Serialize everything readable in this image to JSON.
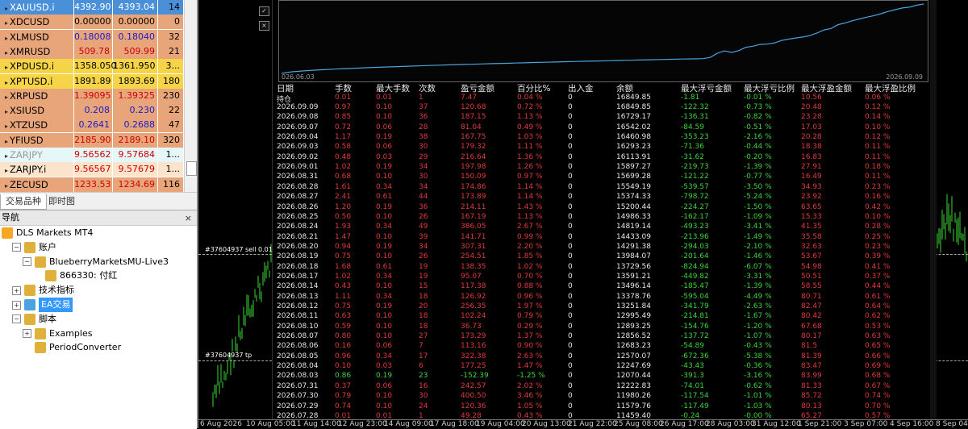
{
  "market_watch": {
    "rows": [
      {
        "symbol": "XAUUSD.i",
        "bid": "4392.90",
        "ask": "4393.04",
        "spread": "14",
        "bg": "#4a90d9",
        "bidcolor": "#ffffff",
        "askcolor": "#ffffff",
        "symcolor": "#ffffff"
      },
      {
        "symbol": "XDCUSD",
        "bid": "0.00000",
        "ask": "0.00000",
        "spread": "0",
        "bg": "#e8a57a",
        "bidcolor": "#000000",
        "askcolor": "#000000",
        "symcolor": "#000000"
      },
      {
        "symbol": "XLMUSD",
        "bid": "0.18008",
        "ask": "0.18040",
        "spread": "32",
        "bg": "#e8a57a",
        "bidcolor": "#1a1acc",
        "askcolor": "#1a1acc",
        "symcolor": "#000000"
      },
      {
        "symbol": "XMRUSD",
        "bid": "509.78",
        "ask": "509.99",
        "spread": "21",
        "bg": "#e8a57a",
        "bidcolor": "#cc0000",
        "askcolor": "#cc0000",
        "symcolor": "#000000"
      },
      {
        "symbol": "XPDUSD.i",
        "bid": "1358.050",
        "ask": "1361.950",
        "spread": "3...",
        "bg": "#f5d547",
        "bidcolor": "#000000",
        "askcolor": "#000000",
        "symcolor": "#000000"
      },
      {
        "symbol": "XPTUSD.i",
        "bid": "1891.89",
        "ask": "1893.69",
        "spread": "180",
        "bg": "#f5d547",
        "bidcolor": "#000000",
        "askcolor": "#000000",
        "symcolor": "#000000"
      },
      {
        "symbol": "XRPUSD",
        "bid": "1.39095",
        "ask": "1.39325",
        "spread": "230",
        "bg": "#e8a57a",
        "bidcolor": "#cc0000",
        "askcolor": "#cc0000",
        "symcolor": "#000000"
      },
      {
        "symbol": "XSIUSD",
        "bid": "0.208",
        "ask": "0.230",
        "spread": "22",
        "bg": "#e8a57a",
        "bidcolor": "#1a1acc",
        "askcolor": "#1a1acc",
        "symcolor": "#000000"
      },
      {
        "symbol": "XTZUSD",
        "bid": "0.2641",
        "ask": "0.2688",
        "spread": "47",
        "bg": "#e8a57a",
        "bidcolor": "#1a1acc",
        "askcolor": "#1a1acc",
        "symcolor": "#000000"
      },
      {
        "symbol": "YFIUSD",
        "bid": "2185.90",
        "ask": "2189.10",
        "spread": "320",
        "bg": "#e8a57a",
        "bidcolor": "#cc0000",
        "askcolor": "#cc0000",
        "symcolor": "#000000"
      },
      {
        "symbol": "ZARJPY",
        "bid": "9.56562",
        "ask": "9.57684",
        "spread": "1...",
        "bg": "#e6f7fa",
        "bidcolor": "#cc0000",
        "askcolor": "#cc0000",
        "symcolor": "#999999"
      },
      {
        "symbol": "ZARJPY.i",
        "bid": "9.56567",
        "ask": "9.57679",
        "spread": "1...",
        "bg": "#fce4cc",
        "bidcolor": "#cc0000",
        "askcolor": "#cc0000",
        "symcolor": "#000000"
      },
      {
        "symbol": "ZECUSD",
        "bid": "1233.53",
        "ask": "1234.69",
        "spread": "116",
        "bg": "#e8a57a",
        "bidcolor": "#cc0000",
        "askcolor": "#cc0000",
        "symcolor": "#000000"
      }
    ],
    "tabs": [
      "交易品种",
      "即时图"
    ]
  },
  "navigator": {
    "title": "导航",
    "close": "×",
    "items": [
      {
        "label": "DLS Markets MT4",
        "indent": 0,
        "pm": "",
        "icon": "#f5a623",
        "name": "nav-broker",
        "iconname": "broker-icon"
      },
      {
        "label": "账户",
        "indent": 1,
        "pm": "−",
        "icon": "#e0b13a",
        "name": "nav-accounts",
        "iconname": "accounts-icon"
      },
      {
        "label": "BlueberryMarketsMU-Live3",
        "indent": 2,
        "pm": "−",
        "icon": "#e0b13a",
        "name": "nav-server",
        "iconname": "server-icon"
      },
      {
        "label": "866330: 付红",
        "indent": 3,
        "pm": "",
        "icon": "#e0b13a",
        "name": "nav-account-866330",
        "iconname": "user-icon"
      },
      {
        "label": "技术指标",
        "indent": 1,
        "pm": "+",
        "icon": "#e0b13a",
        "name": "nav-indicators",
        "iconname": "indicators-icon"
      },
      {
        "label": "EA交易",
        "indent": 1,
        "pm": "+",
        "icon": "#4aa3df",
        "name": "nav-expert-advisors",
        "iconname": "ea-icon",
        "selected": true
      },
      {
        "label": "脚本",
        "indent": 1,
        "pm": "−",
        "icon": "#e0b13a",
        "name": "nav-scripts",
        "iconname": "scripts-icon"
      },
      {
        "label": "Examples",
        "indent": 2,
        "pm": "+",
        "icon": "#e0b13a",
        "name": "nav-examples",
        "iconname": "folder-icon"
      },
      {
        "label": "PeriodConverter",
        "indent": 2,
        "pm": "",
        "icon": "#e0b13a",
        "name": "nav-periodconverter",
        "iconname": "script-icon"
      }
    ]
  },
  "chart": {
    "order_label_sell": "#37604937 sell 0.01",
    "order_label_tp": "#37604937 tp",
    "time_labels": [
      "6 Aug 2026",
      "10 Aug 05:00",
      "11 Aug 14:00",
      "12 Aug 23:00",
      "14 Aug 09:00",
      "17 Aug 18:00",
      "19 Aug 04:00",
      "20 Aug 13:00",
      "21 Aug 22:00",
      "25 Aug 08:00",
      "26 Aug 17:00",
      "28 Aug 03:00",
      "31 Aug 12:00",
      "1 Sep 21:00",
      "3 Sep 07:00",
      "4 Sep 16:00",
      "8 Sep 04:00"
    ],
    "btn_symbol": "✓",
    "btn_close": "×"
  },
  "report": {
    "eq_start": "026.06.03",
    "eq_end": "2026.09.09",
    "headers": [
      "日期",
      "手数",
      "最大手数",
      "次数",
      "盈亏金额",
      "百分比%",
      "出入金",
      "余额",
      "最大浮亏金额",
      "最大浮亏比例",
      "最大浮盈金额",
      "最大浮盈比例"
    ],
    "holding": {
      "date": "持仓",
      "lots": "0.01",
      "maxlots": "0.01",
      "count": "1",
      "pl": "7.47",
      "pct": "0.04 %",
      "dw": "0",
      "balance": "16849.85",
      "maxdd": "-1.81",
      "maxddp": "-0.01 %",
      "maxrun": "10.56",
      "maxrunp": "0.06 %"
    },
    "rows": [
      [
        "2026.09.09",
        "0.97",
        "0.10",
        "37",
        "120.68",
        "0.72 %",
        "0",
        "16849.85",
        "-122.32",
        "-0.73 %",
        "20.48",
        "0.12 %"
      ],
      [
        "2026.09.08",
        "0.85",
        "0.10",
        "36",
        "187.15",
        "1.13 %",
        "0",
        "16729.17",
        "-136.31",
        "-0.82 %",
        "23.28",
        "0.14 %"
      ],
      [
        "2026.09.07",
        "0.72",
        "0.06",
        "28",
        "81.04",
        "0.49 %",
        "0",
        "16542.02",
        "-84.59",
        "-0.51 %",
        "17.03",
        "0.10 %"
      ],
      [
        "2026.09.04",
        "1.17",
        "0.19",
        "38",
        "167.75",
        "1.03 %",
        "0",
        "16460.98",
        "-353.23",
        "-2.16 %",
        "20.28",
        "0.12 %"
      ],
      [
        "2026.09.03",
        "0.58",
        "0.06",
        "30",
        "179.32",
        "1.11 %",
        "0",
        "16293.23",
        "-71.36",
        "-0.44 %",
        "18.38",
        "0.11 %"
      ],
      [
        "2026.09.02",
        "0.48",
        "0.03",
        "29",
        "216.64",
        "1.36 %",
        "0",
        "16113.91",
        "-31.62",
        "-0.20 %",
        "16.83",
        "0.11 %"
      ],
      [
        "2026.09.01",
        "1.02",
        "0.19",
        "34",
        "197.98",
        "1.26 %",
        "0",
        "15897.27",
        "-219.73",
        "-1.39 %",
        "27.91",
        "0.18 %"
      ],
      [
        "2026.08.31",
        "0.68",
        "0.10",
        "30",
        "150.09",
        "0.97 %",
        "0",
        "15699.28",
        "-121.22",
        "-0.77 %",
        "16.49",
        "0.11 %"
      ],
      [
        "2026.08.28",
        "1.61",
        "0.34",
        "34",
        "174.86",
        "1.14 %",
        "0",
        "15549.19",
        "-539.57",
        "-3.50 %",
        "34.93",
        "0.23 %"
      ],
      [
        "2026.08.27",
        "2.41",
        "0.61",
        "44",
        "173.89",
        "1.14 %",
        "0",
        "15374.33",
        "-798.72",
        "-5.24 %",
        "23.92",
        "0.16 %"
      ],
      [
        "2026.08.26",
        "1.20",
        "0.19",
        "36",
        "214.11",
        "1.43 %",
        "0",
        "15200.44",
        "-224.27",
        "-1.50 %",
        "63.65",
        "0.42 %"
      ],
      [
        "2026.08.25",
        "0.50",
        "0.10",
        "26",
        "167.19",
        "1.13 %",
        "0",
        "14986.33",
        "-162.17",
        "-1.09 %",
        "15.33",
        "0.10 %"
      ],
      [
        "2026.08.24",
        "1.93",
        "0.34",
        "49",
        "386.05",
        "2.67 %",
        "0",
        "14819.14",
        "-493.23",
        "-3.41 %",
        "41.35",
        "0.28 %"
      ],
      [
        "2026.08.21",
        "1.47",
        "0.10",
        "39",
        "141.71",
        "0.99 %",
        "0",
        "14433.09",
        "-213.96",
        "-1.49 %",
        "35.58",
        "0.25 %"
      ],
      [
        "2026.08.20",
        "0.94",
        "0.19",
        "34",
        "307.31",
        "2.20 %",
        "0",
        "14291.38",
        "-294.03",
        "-2.10 %",
        "32.63",
        "0.23 %"
      ],
      [
        "2026.08.19",
        "0.75",
        "0.10",
        "26",
        "254.51",
        "1.85 %",
        "0",
        "13984.07",
        "-201.64",
        "-1.46 %",
        "53.67",
        "0.39 %"
      ],
      [
        "2026.08.18",
        "1.68",
        "0.61",
        "19",
        "138.35",
        "1.02 %",
        "0",
        "13729.56",
        "-824.94",
        "-6.07 %",
        "54.98",
        "0.41 %"
      ],
      [
        "2026.08.17",
        "1.02",
        "0.34",
        "19",
        "95.07",
        "0.70 %",
        "0",
        "13591.21",
        "-449.82",
        "-3.31 %",
        "50.51",
        "0.37 %"
      ],
      [
        "2026.08.14",
        "0.43",
        "0.10",
        "15",
        "117.38",
        "0.88 %",
        "0",
        "13496.14",
        "-185.47",
        "-1.39 %",
        "58.55",
        "0.44 %"
      ],
      [
        "2026.08.13",
        "1.11",
        "0.34",
        "18",
        "126.92",
        "0.96 %",
        "0",
        "13378.76",
        "-595.04",
        "-4.49 %",
        "80.71",
        "0.61 %"
      ],
      [
        "2026.08.12",
        "0.75",
        "0.19",
        "20",
        "256.35",
        "1.97 %",
        "0",
        "13251.84",
        "-341.79",
        "-2.63 %",
        "82.47",
        "0.64 %"
      ],
      [
        "2026.08.11",
        "0.63",
        "0.10",
        "18",
        "102.24",
        "0.79 %",
        "0",
        "12995.49",
        "-214.81",
        "-1.67 %",
        "80.42",
        "0.62 %"
      ],
      [
        "2026.08.10",
        "0.59",
        "0.10",
        "18",
        "36.73",
        "0.29 %",
        "0",
        "12893.25",
        "-154.76",
        "-1.20 %",
        "67.68",
        "0.53 %"
      ],
      [
        "2026.08.07",
        "0.80",
        "0.10",
        "27",
        "173.29",
        "1.37 %",
        "0",
        "12856.52",
        "-137.72",
        "-1.07 %",
        "80.17",
        "0.63 %"
      ],
      [
        "2026.08.06",
        "0.16",
        "0.06",
        "7",
        "113.16",
        "0.90 %",
        "0",
        "12683.23",
        "-54.89",
        "-0.43 %",
        "81.5",
        "0.65 %"
      ],
      [
        "2026.08.05",
        "0.96",
        "0.34",
        "17",
        "322.38",
        "2.63 %",
        "0",
        "12570.07",
        "-672.36",
        "-5.38 %",
        "81.39",
        "0.66 %"
      ],
      [
        "2026.08.04",
        "0.10",
        "0.03",
        "6",
        "177.25",
        "1.47 %",
        "0",
        "12247.69",
        "-43.43",
        "-0.36 %",
        "83.47",
        "0.69 %"
      ],
      [
        "2026.08.03",
        "0.86",
        "0.19",
        "23",
        "-152.39",
        "-1.25 %",
        "0",
        "12070.44",
        "-391.3",
        "-3.16 %",
        "83.99",
        "0.68 %"
      ],
      [
        "2026.07.31",
        "0.37",
        "0.06",
        "16",
        "242.57",
        "2.02 %",
        "0",
        "12222.83",
        "-74.01",
        "-0.62 %",
        "81.33",
        "0.67 %"
      ],
      [
        "2026.07.30",
        "0.79",
        "0.10",
        "30",
        "400.50",
        "3.46 %",
        "0",
        "11980.26",
        "-117.54",
        "-1.01 %",
        "85.72",
        "0.74 %"
      ],
      [
        "2026.07.29",
        "0.74",
        "0.10",
        "24",
        "120.36",
        "1.05 %",
        "0",
        "11579.76",
        "-117.49",
        "-1.03 %",
        "80.13",
        "0.70 %"
      ],
      [
        "2026.07.28",
        "0.01",
        "0.01",
        "1",
        "49.28",
        "0.43 %",
        "0",
        "11459.40",
        "-0.24",
        "-0.00 %",
        "65.27",
        "0.57 %"
      ]
    ]
  },
  "colors": {
    "equity_curve": "#4aa3df",
    "profit_red": "#e03b3b",
    "loss_green": "#3cd33c",
    "candle_green": "#39d839",
    "neutral": "#e6e6e6"
  }
}
